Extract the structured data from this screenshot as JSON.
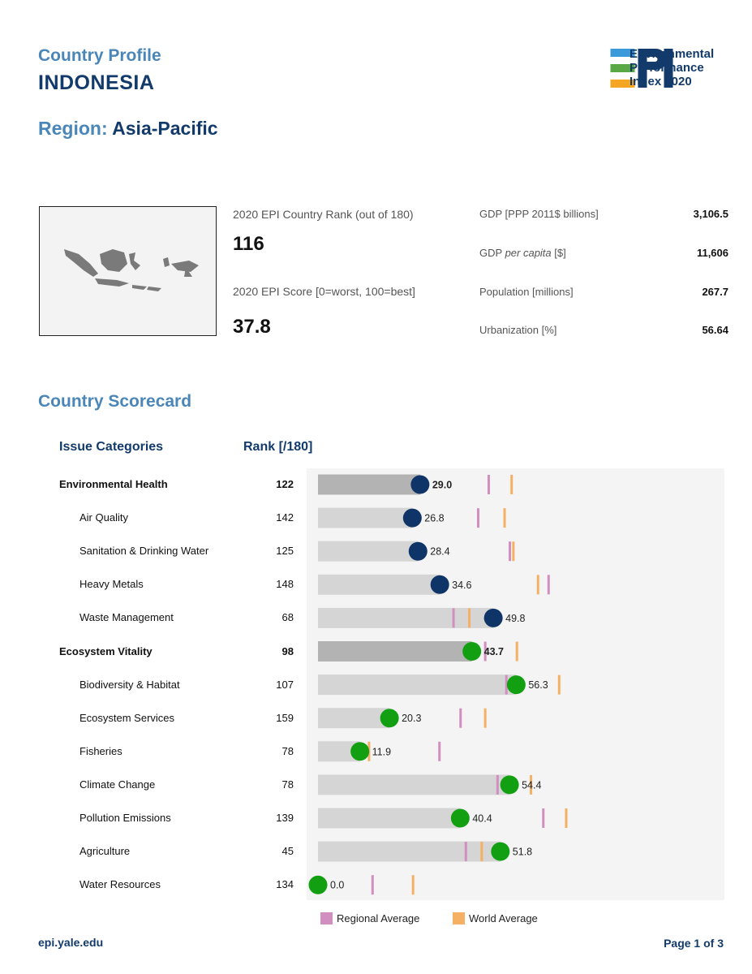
{
  "header": {
    "profile_label": "Country Profile",
    "country": "INDONESIA",
    "region_label": "Region:",
    "region_value": "Asia-Pacific"
  },
  "logo": {
    "mark": "EPI",
    "line1": "Environmental",
    "line2": "Performance",
    "line3": "Index 2020",
    "colors": {
      "blue_light": "#3a9ad9",
      "green": "#5aa845",
      "orange": "#f5a623",
      "navy": "#123a6b"
    }
  },
  "summary": {
    "rank_label": "2020 EPI Country Rank (out of 180)",
    "rank_value": "116",
    "score_label": "2020 EPI Score [0=worst, 100=best]",
    "score_value": "37.8",
    "stats": [
      {
        "label": "GDP [PPP 2011$ billions]",
        "value": "3,106.5"
      },
      {
        "label_pre": "GDP ",
        "label_em": "per capita",
        "label_post": " [$]",
        "value": "11,606"
      },
      {
        "label": "Population [millions]",
        "value": "267.7"
      },
      {
        "label": "Urbanization [%]",
        "value": "56.64"
      }
    ]
  },
  "scorecard": {
    "title": "Country Scorecard",
    "col_categories": "Issue Categories",
    "col_rank": "Rank [/180]",
    "rows": [
      {
        "name": "Environmental Health",
        "rank": "122",
        "score": 29.0,
        "regional": 48.5,
        "world": 55.0,
        "main": true,
        "group": "eh"
      },
      {
        "name": "Air Quality",
        "rank": "142",
        "score": 26.8,
        "regional": 45.5,
        "world": 53.0,
        "main": false,
        "group": "eh"
      },
      {
        "name": "Sanitation & Drinking Water",
        "rank": "125",
        "score": 28.4,
        "regional": 54.5,
        "world": 55.5,
        "main": false,
        "group": "eh"
      },
      {
        "name": "Heavy Metals",
        "rank": "148",
        "score": 34.6,
        "regional": 65.5,
        "world": 62.5,
        "main": false,
        "group": "eh"
      },
      {
        "name": "Waste Management",
        "rank": "68",
        "score": 49.8,
        "regional": 38.5,
        "world": 43.0,
        "main": false,
        "group": "eh"
      },
      {
        "name": "Ecosystem Vitality",
        "rank": "98",
        "score": 43.7,
        "regional": 47.5,
        "world": 56.5,
        "main": true,
        "group": "ev"
      },
      {
        "name": "Biodiversity & Habitat",
        "rank": "107",
        "score": 56.3,
        "regional": 53.5,
        "world": 68.5,
        "main": false,
        "group": "ev"
      },
      {
        "name": "Ecosystem Services",
        "rank": "159",
        "score": 20.3,
        "regional": 40.5,
        "world": 47.5,
        "main": false,
        "group": "ev"
      },
      {
        "name": "Fisheries",
        "rank": "78",
        "score": 11.9,
        "regional": 34.5,
        "world": 14.5,
        "main": false,
        "group": "ev"
      },
      {
        "name": "Climate Change",
        "rank": "78",
        "score": 54.4,
        "regional": 51.0,
        "world": 60.5,
        "main": false,
        "group": "ev"
      },
      {
        "name": "Pollution Emissions",
        "rank": "139",
        "score": 40.4,
        "regional": 64.0,
        "world": 70.5,
        "main": false,
        "group": "ev"
      },
      {
        "name": "Agriculture",
        "rank": "45",
        "score": 51.8,
        "regional": 42.0,
        "world": 46.5,
        "main": false,
        "group": "ev"
      },
      {
        "name": "Water Resources",
        "rank": "134",
        "score": 0.0,
        "regional": 15.5,
        "world": 27.0,
        "main": false,
        "group": "ev"
      }
    ],
    "legend": {
      "regional": "Regional Average",
      "world": "World Average"
    },
    "colors": {
      "bar_main": "#b3b3b3",
      "bar_sub": "#d5d5d5",
      "dot_eh": "#0f3468",
      "dot_ev": "#12a012",
      "regional": "#d08fbf",
      "world": "#f5b063"
    }
  },
  "chart_data": {
    "type": "bar",
    "categories": [
      "Environmental Health",
      "Air Quality",
      "Sanitation & Drinking Water",
      "Heavy Metals",
      "Waste Management",
      "Ecosystem Vitality",
      "Biodiversity & Habitat",
      "Ecosystem Services",
      "Fisheries",
      "Climate Change",
      "Pollution Emissions",
      "Agriculture",
      "Water Resources"
    ],
    "series": [
      {
        "name": "Regional Average",
        "values": [
          48.5,
          45.5,
          54.5,
          65.5,
          38.5,
          47.5,
          53.5,
          40.5,
          34.5,
          51.0,
          64.0,
          42.0,
          15.5
        ]
      },
      {
        "name": "World Average",
        "values": [
          55.0,
          53.0,
          55.5,
          62.5,
          43.0,
          56.5,
          68.5,
          47.5,
          14.5,
          60.5,
          70.5,
          46.5,
          27.0
        ]
      }
    ],
    "scores": [
      29.0,
      26.8,
      28.4,
      34.6,
      49.8,
      43.7,
      56.3,
      20.3,
      11.9,
      54.4,
      40.4,
      51.8,
      0.0
    ],
    "xlim": [
      0,
      100
    ],
    "legend": "bottom"
  },
  "footer": {
    "url": "epi.yale.edu",
    "page": "Page 1 of 3"
  }
}
